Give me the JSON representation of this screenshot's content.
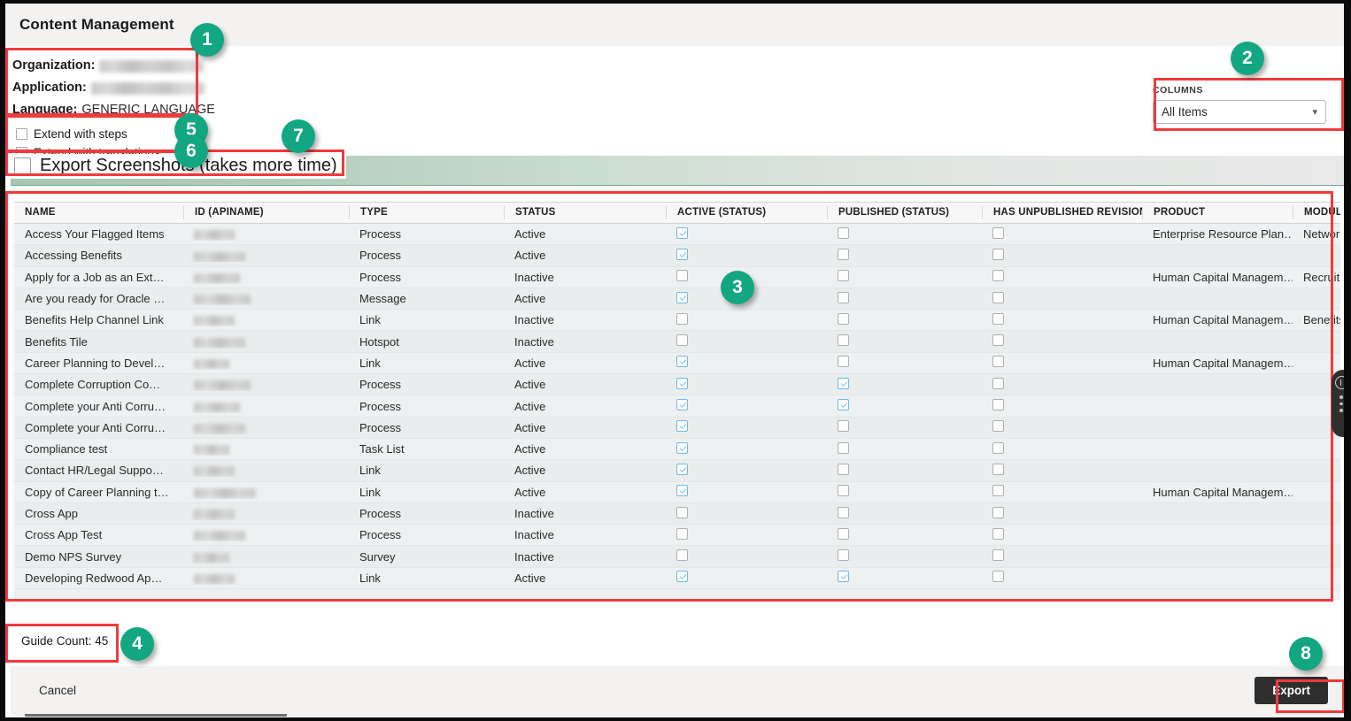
{
  "dialog": {
    "title": "Content Management"
  },
  "meta": {
    "organization_label": "Organization:",
    "organization_value": "",
    "application_label": "Application:",
    "application_value": "",
    "language_label": "Language:",
    "language_value": "GENERIC LANGUAGE"
  },
  "options": {
    "extend_with_steps": "Extend with steps",
    "extend_with_translations": "Extend with translations",
    "export_screenshots": "Export Screenshots (takes more time)"
  },
  "columns_panel": {
    "label": "COLUMNS",
    "selected": "All Items",
    "caret": "chevron-down-icon"
  },
  "table": {
    "headers": [
      "NAME",
      "ID (APINAME)",
      "TYPE",
      "STATUS",
      "ACTIVE (STATUS)",
      "PUBLISHED (STATUS)",
      "HAS UNPUBLISHED REVISION",
      "PRODUCT",
      "MODULE"
    ],
    "rows": [
      {
        "name": "Access Your Flagged Items",
        "id": "",
        "type": "Process",
        "status": "Active",
        "active": true,
        "published": false,
        "unpublished": false,
        "product": "Enterprise Resource Plan…",
        "module": "Network"
      },
      {
        "name": "Accessing Benefits",
        "id": "",
        "type": "Process",
        "status": "Active",
        "active": true,
        "published": false,
        "unpublished": false,
        "product": "",
        "module": ""
      },
      {
        "name": "Apply for a Job as an Ext…",
        "id": "",
        "type": "Process",
        "status": "Inactive",
        "active": false,
        "published": false,
        "unpublished": false,
        "product": "Human Capital Managem…",
        "module": "Recruitm"
      },
      {
        "name": "Are you ready for Oracle …",
        "id": "",
        "type": "Message",
        "status": "Active",
        "active": true,
        "published": false,
        "unpublished": false,
        "product": "",
        "module": ""
      },
      {
        "name": "Benefits Help Channel Link",
        "id": "",
        "type": "Link",
        "status": "Inactive",
        "active": false,
        "published": false,
        "unpublished": false,
        "product": "Human Capital Managem…",
        "module": "Benefits"
      },
      {
        "name": "Benefits Tile",
        "id": "",
        "type": "Hotspot",
        "status": "Inactive",
        "active": false,
        "published": false,
        "unpublished": false,
        "product": "",
        "module": ""
      },
      {
        "name": "Career Planning to Devel…",
        "id": "",
        "type": "Link",
        "status": "Active",
        "active": true,
        "published": false,
        "unpublished": false,
        "product": "Human Capital Managem…",
        "module": ""
      },
      {
        "name": "Complete Corruption Co…",
        "id": "",
        "type": "Process",
        "status": "Active",
        "active": true,
        "published": true,
        "unpublished": false,
        "product": "",
        "module": ""
      },
      {
        "name": "Complete your Anti Corru…",
        "id": "",
        "type": "Process",
        "status": "Active",
        "active": true,
        "published": true,
        "unpublished": false,
        "product": "",
        "module": ""
      },
      {
        "name": "Complete your Anti Corru…",
        "id": "",
        "type": "Process",
        "status": "Active",
        "active": true,
        "published": false,
        "unpublished": false,
        "product": "",
        "module": ""
      },
      {
        "name": "Compliance test",
        "id": "",
        "type": "Task List",
        "status": "Active",
        "active": true,
        "published": false,
        "unpublished": false,
        "product": "",
        "module": ""
      },
      {
        "name": "Contact HR/Legal Suppo…",
        "id": "",
        "type": "Link",
        "status": "Active",
        "active": true,
        "published": false,
        "unpublished": false,
        "product": "",
        "module": ""
      },
      {
        "name": "Copy of Career Planning t…",
        "id": "",
        "type": "Link",
        "status": "Active",
        "active": true,
        "published": false,
        "unpublished": false,
        "product": "Human Capital Managem…",
        "module": ""
      },
      {
        "name": "Cross App",
        "id": "",
        "type": "Process",
        "status": "Inactive",
        "active": false,
        "published": false,
        "unpublished": false,
        "product": "",
        "module": ""
      },
      {
        "name": "Cross App Test",
        "id": "",
        "type": "Process",
        "status": "Inactive",
        "active": false,
        "published": false,
        "unpublished": false,
        "product": "",
        "module": ""
      },
      {
        "name": "Demo NPS Survey",
        "id": "",
        "type": "Survey",
        "status": "Inactive",
        "active": false,
        "published": false,
        "unpublished": false,
        "product": "",
        "module": ""
      },
      {
        "name": "Developing Redwood Ap…",
        "id": "",
        "type": "Link",
        "status": "Active",
        "active": true,
        "published": true,
        "unpublished": false,
        "product": "",
        "module": ""
      }
    ]
  },
  "guide_count": "Guide Count: 45",
  "footer": {
    "cancel": "Cancel",
    "export": "Export"
  },
  "annotations": {
    "badges": [
      "1",
      "2",
      "3",
      "4",
      "5",
      "6",
      "7",
      "8"
    ],
    "accent_color": "#12a683",
    "box_color": "#ef3b3b"
  },
  "edge_widget": {
    "help_icon": "help-circle-icon",
    "more_icon": "more-vertical-icon"
  }
}
